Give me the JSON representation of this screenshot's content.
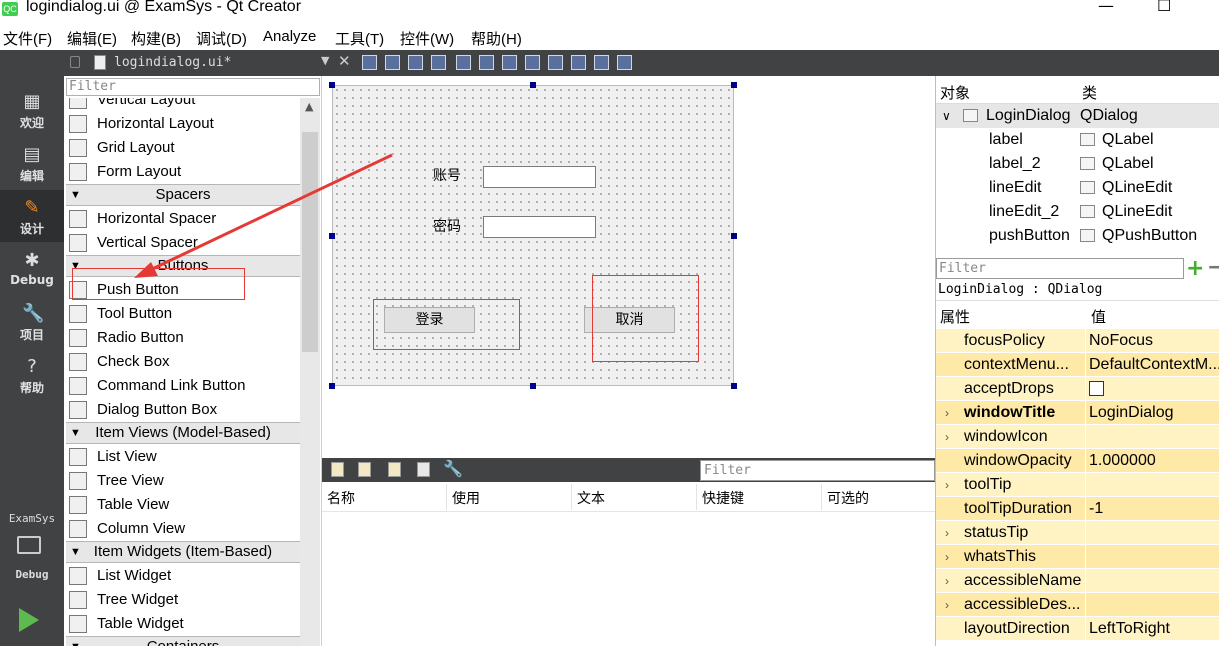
{
  "window": {
    "title": "logindialog.ui @ ExamSys - Qt Creator",
    "app_icon": "QC",
    "minimize": "—",
    "maximize": "☐"
  },
  "menu": [
    "文件(F)",
    "编辑(E)",
    "构建(B)",
    "调试(D)",
    "Analyze",
    "工具(T)",
    "控件(W)",
    "帮助(H)"
  ],
  "editor_tab": {
    "filename": "logindialog.ui*"
  },
  "modes": [
    {
      "label": "欢迎",
      "icon": "grid-icon"
    },
    {
      "label": "编辑",
      "icon": "edit-icon"
    },
    {
      "label": "设计",
      "icon": "design-pen-icon"
    },
    {
      "label": "Debug",
      "icon": "bug-icon"
    },
    {
      "label": "项目",
      "icon": "wrench-icon"
    },
    {
      "label": "帮助",
      "icon": "help-icon"
    }
  ],
  "kit": {
    "project": "ExamSys",
    "build": "Debug"
  },
  "widget_box": {
    "filter_placeholder": "Filter",
    "entries": [
      {
        "kind": "item",
        "label": "Vertical Layout",
        "icon": "vertical-layout-icon"
      },
      {
        "kind": "item",
        "label": "Horizontal Layout",
        "icon": "horizontal-layout-icon"
      },
      {
        "kind": "item",
        "label": "Grid Layout",
        "icon": "grid-layout-icon"
      },
      {
        "kind": "item",
        "label": "Form Layout",
        "icon": "form-layout-icon"
      },
      {
        "kind": "category",
        "label": "Spacers"
      },
      {
        "kind": "item",
        "label": "Horizontal Spacer",
        "icon": "horizontal-spacer-icon"
      },
      {
        "kind": "item",
        "label": "Vertical Spacer",
        "icon": "vertical-spacer-icon"
      },
      {
        "kind": "category",
        "label": "Buttons"
      },
      {
        "kind": "item",
        "label": "Push Button",
        "icon": "push-button-icon"
      },
      {
        "kind": "item",
        "label": "Tool Button",
        "icon": "tool-button-icon"
      },
      {
        "kind": "item",
        "label": "Radio Button",
        "icon": "radio-button-icon"
      },
      {
        "kind": "item",
        "label": "Check Box",
        "icon": "check-box-icon"
      },
      {
        "kind": "item",
        "label": "Command Link Button",
        "icon": "command-link-icon"
      },
      {
        "kind": "item",
        "label": "Dialog Button Box",
        "icon": "dialog-button-box-icon"
      },
      {
        "kind": "category",
        "label": "Item Views (Model-Based)"
      },
      {
        "kind": "item",
        "label": "List View",
        "icon": "list-view-icon"
      },
      {
        "kind": "item",
        "label": "Tree View",
        "icon": "tree-view-icon"
      },
      {
        "kind": "item",
        "label": "Table View",
        "icon": "table-view-icon"
      },
      {
        "kind": "item",
        "label": "Column View",
        "icon": "column-view-icon"
      },
      {
        "kind": "category",
        "label": "Item Widgets (Item-Based)"
      },
      {
        "kind": "item",
        "label": "List Widget",
        "icon": "list-widget-icon"
      },
      {
        "kind": "item",
        "label": "Tree Widget",
        "icon": "tree-widget-icon"
      },
      {
        "kind": "item",
        "label": "Table Widget",
        "icon": "table-widget-icon"
      },
      {
        "kind": "category",
        "label": "Containers"
      }
    ]
  },
  "form": {
    "account_label": "账号",
    "password_label": "密码",
    "login_button": "登录",
    "cancel_button": "取消"
  },
  "action_editor": {
    "filter_placeholder": "Filter",
    "columns": [
      "名称",
      "使用",
      "文本",
      "快捷键",
      "可选的"
    ]
  },
  "object_inspector": {
    "headers": [
      "对象",
      "类"
    ],
    "rows": [
      {
        "name": "LoginDialog",
        "class": "QDialog",
        "icon": "dialog-icon"
      },
      {
        "name": "label",
        "class": "QLabel",
        "icon": "label-tag-icon"
      },
      {
        "name": "label_2",
        "class": "QLabel",
        "icon": "label-tag-icon"
      },
      {
        "name": "lineEdit",
        "class": "QLineEdit",
        "icon": "line-edit-icon"
      },
      {
        "name": "lineEdit_2",
        "class": "QLineEdit",
        "icon": "line-edit-icon"
      },
      {
        "name": "pushButton",
        "class": "QPushButton",
        "icon": "push-button-icon"
      }
    ]
  },
  "property_editor": {
    "filter_placeholder": "Filter",
    "object_class": "LoginDialog : QDialog",
    "headers": [
      "属性",
      "值"
    ],
    "rows": [
      {
        "name": "focusPolicy",
        "value": "NoFocus",
        "expand": ""
      },
      {
        "name": "contextMenu...",
        "value": "DefaultContextM...",
        "expand": ""
      },
      {
        "name": "acceptDrops",
        "value": "",
        "expand": ""
      },
      {
        "name": "windowTitle",
        "value": "LoginDialog",
        "expand": "›"
      },
      {
        "name": "windowIcon",
        "value": "",
        "expand": "›"
      },
      {
        "name": "windowOpacity",
        "value": "1.000000",
        "expand": ""
      },
      {
        "name": "toolTip",
        "value": "",
        "expand": "›"
      },
      {
        "name": "toolTipDuration",
        "value": "-1",
        "expand": ""
      },
      {
        "name": "statusTip",
        "value": "",
        "expand": "›"
      },
      {
        "name": "whatsThis",
        "value": "",
        "expand": "›"
      },
      {
        "name": "accessibleName",
        "value": "",
        "expand": "›"
      },
      {
        "name": "accessibleDes...",
        "value": "",
        "expand": "›"
      },
      {
        "name": "layoutDirection",
        "value": "LeftToRight",
        "expand": ""
      }
    ]
  },
  "colors": {
    "annotation_red": "#e53935",
    "run_green": "#5dba4f",
    "panel_dark": "#404244",
    "property_yellow": "#fff3c4"
  }
}
